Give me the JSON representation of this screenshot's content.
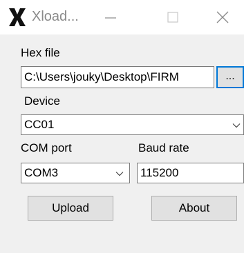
{
  "window": {
    "title": "Xload...",
    "icon": "x-logo-icon",
    "controls": [
      "minimize-icon",
      "maximize-icon",
      "close-icon"
    ]
  },
  "hex_file": {
    "label": "Hex file",
    "value": "C:\\Users\\jouky\\Desktop\\FIRM",
    "browse_label": "..."
  },
  "device": {
    "label": "Device",
    "selected": "CC01"
  },
  "com_port": {
    "label": "COM port",
    "selected": "COM3"
  },
  "baud_rate": {
    "label": "Baud rate",
    "value": "115200"
  },
  "buttons": {
    "upload": "Upload",
    "about": "About"
  },
  "colors": {
    "accent": "#0078d7",
    "client_bg": "#f0f0f0",
    "button_bg": "#e1e1e1"
  }
}
